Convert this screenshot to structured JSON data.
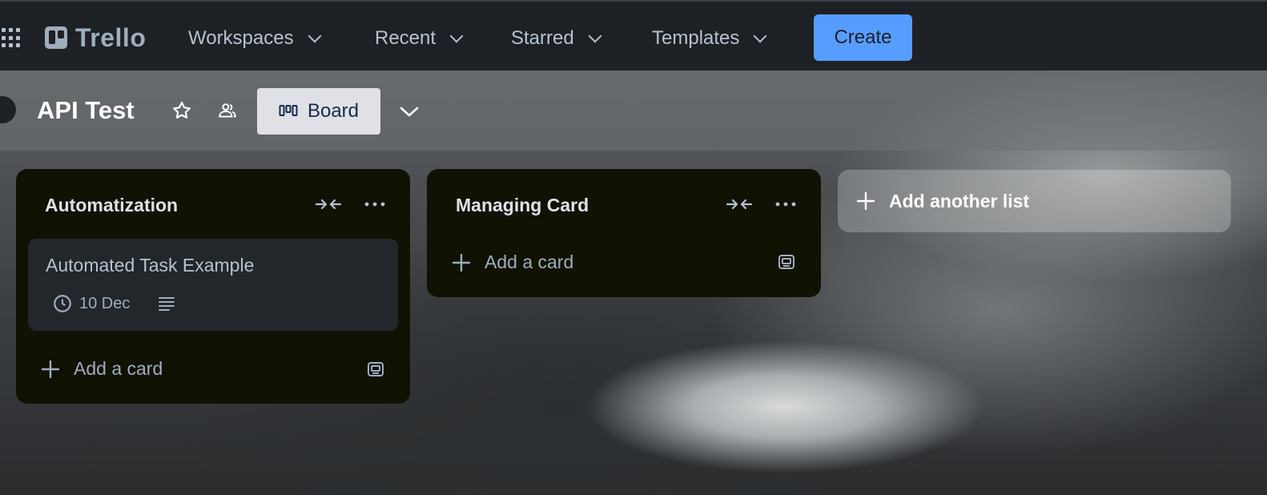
{
  "nav": {
    "logo_text": "Trello",
    "workspaces": "Workspaces",
    "recent": "Recent",
    "starred": "Starred",
    "templates": "Templates",
    "create": "Create"
  },
  "board": {
    "title": "API Test",
    "view_label": "Board"
  },
  "lists": [
    {
      "title": "Automatization",
      "cards": [
        {
          "title": "Automated Task Example",
          "due": "10 Dec"
        }
      ],
      "add_card": "Add a card"
    },
    {
      "title": "Managing Card",
      "cards": [],
      "add_card": "Add a card"
    }
  ],
  "add_list": "Add another list",
  "colors": {
    "nav_bg": "#1d2125",
    "create_bg": "#579dff",
    "list_bg": "#101204",
    "card_bg": "#22272b"
  }
}
